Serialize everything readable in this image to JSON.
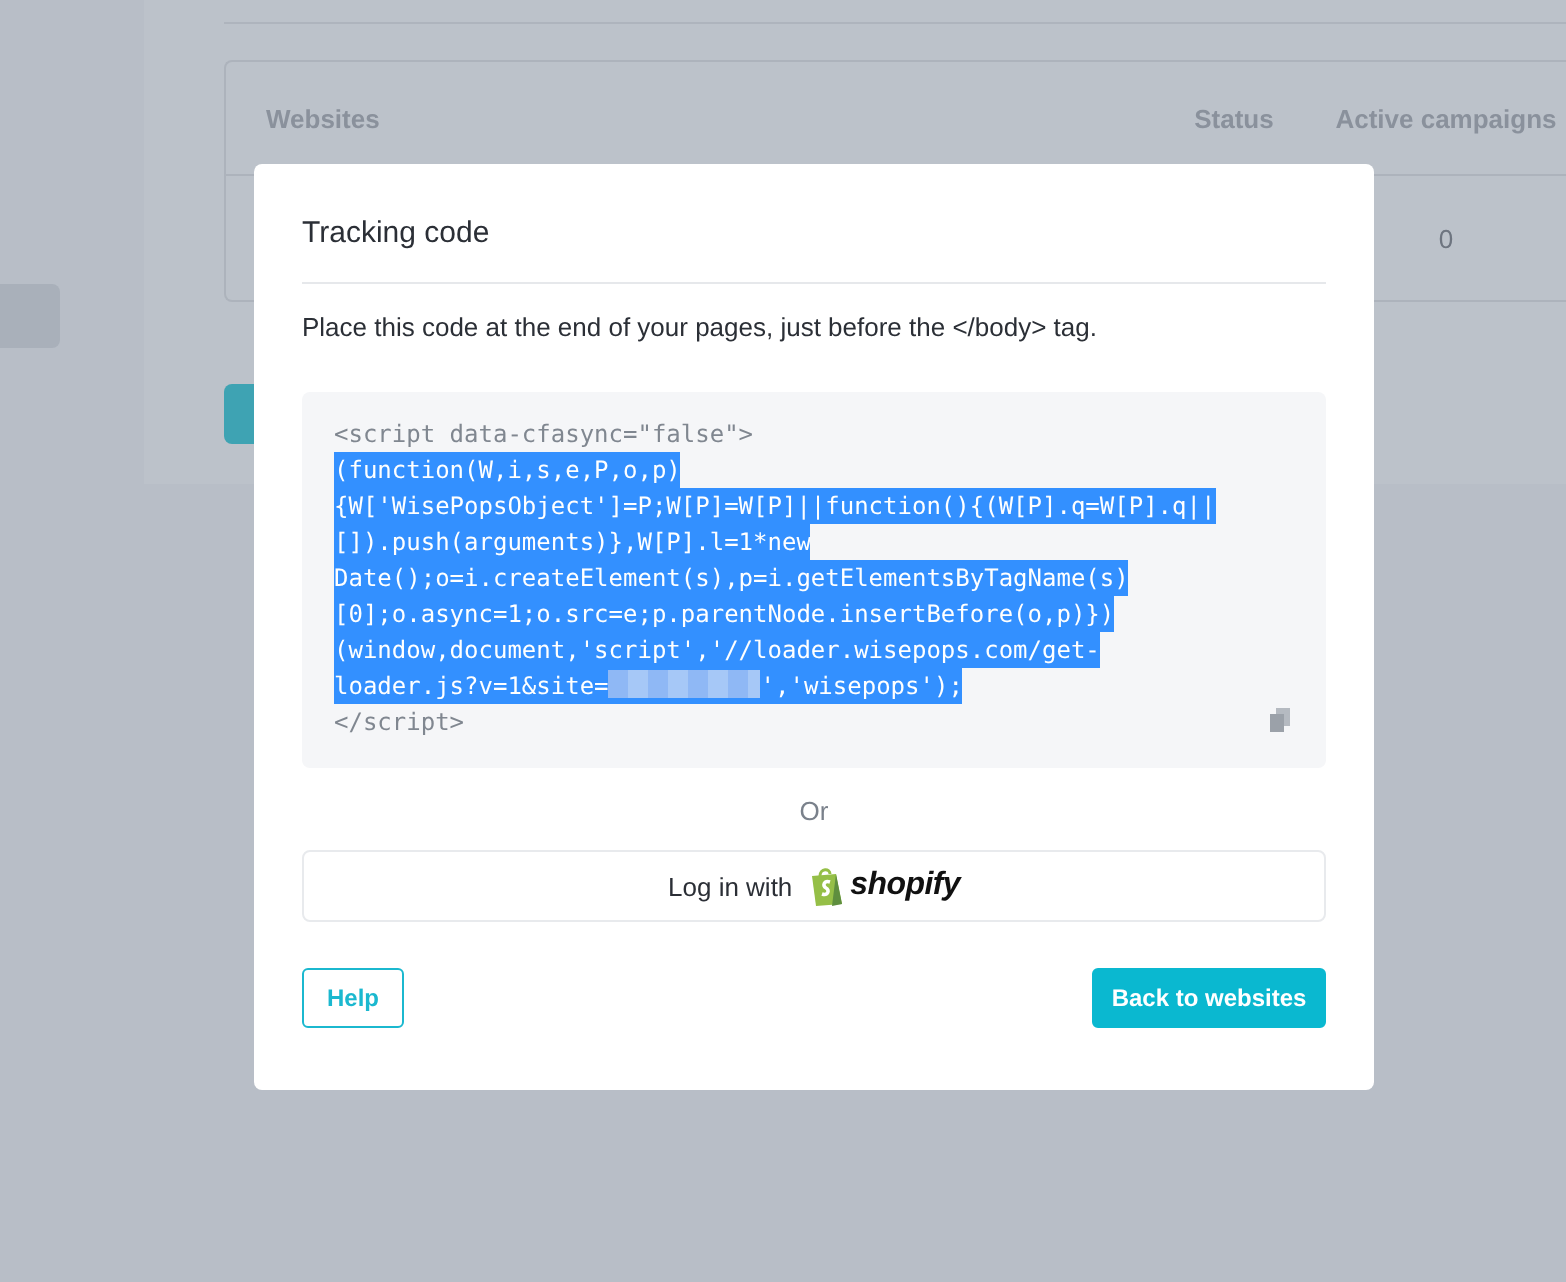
{
  "background": {
    "table": {
      "columns": [
        "Websites",
        "Status",
        "Active campaigns"
      ],
      "rows": [
        {
          "active_campaigns": "0"
        }
      ]
    }
  },
  "modal": {
    "title": "Tracking code",
    "instruction": "Place this code at the end of your pages, just before the </body> tag.",
    "code_lines": [
      {
        "selected": false,
        "parts": [
          {
            "kind": "text",
            "text": "<script data-cfasync=\"false\">"
          }
        ]
      },
      {
        "selected": true,
        "parts": [
          {
            "kind": "text",
            "text": "(function(W,i,s,e,P,o,p)"
          }
        ]
      },
      {
        "selected": true,
        "parts": [
          {
            "kind": "text",
            "text": "{W['WisePopsObject']=P;W[P]=W[P]||function(){(W[P].q=W[P].q||"
          }
        ]
      },
      {
        "selected": true,
        "parts": [
          {
            "kind": "text",
            "text": "[]).push(arguments)},W[P].l=1*new"
          }
        ]
      },
      {
        "selected": true,
        "parts": [
          {
            "kind": "text",
            "text": "Date();o=i.createElement(s),p=i.getElementsByTagName(s)"
          }
        ]
      },
      {
        "selected": true,
        "parts": [
          {
            "kind": "text",
            "text": "[0];o.async=1;o.src=e;p.parentNode.insertBefore(o,p)})"
          }
        ]
      },
      {
        "selected": true,
        "parts": [
          {
            "kind": "text",
            "text": "(window,document,'script','//loader.wisepops.com/get-"
          }
        ]
      },
      {
        "selected": true,
        "parts": [
          {
            "kind": "text",
            "text": "loader.js?v=1&site="
          },
          {
            "kind": "redacted"
          },
          {
            "kind": "text",
            "text": "','wisepops');"
          }
        ]
      },
      {
        "selected": false,
        "parts": [
          {
            "kind": "text",
            "text": "</script>"
          }
        ]
      }
    ],
    "separator": "Or",
    "shopify_button": {
      "label": "Log in with",
      "logo_text": "shopify"
    },
    "buttons": [
      {
        "label": "Help",
        "kind": "outline"
      },
      {
        "label": "Back to websites",
        "kind": "primary"
      }
    ]
  }
}
